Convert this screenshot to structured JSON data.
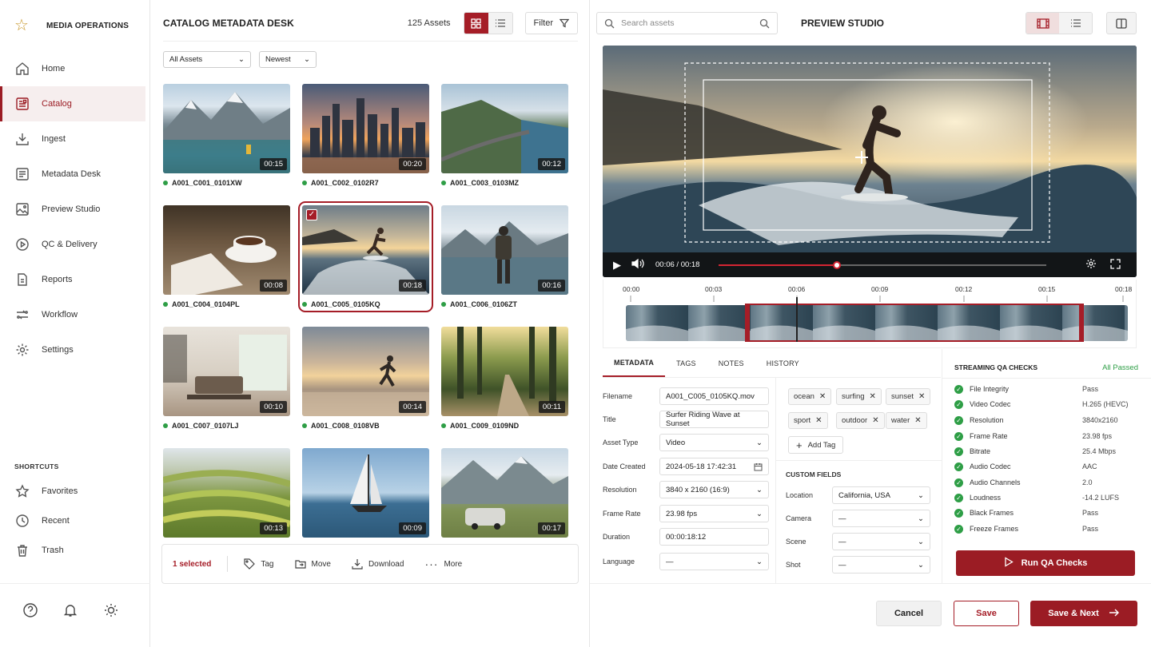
{
  "app": {
    "name": "MEDIA OPERATIONS"
  },
  "sidebar": {
    "items": [
      {
        "label": "Home"
      },
      {
        "label": "Catalog"
      },
      {
        "label": "Ingest"
      },
      {
        "label": "Metadata Desk"
      },
      {
        "label": "Preview Studio"
      },
      {
        "label": "QC & Delivery"
      },
      {
        "label": "Reports"
      },
      {
        "label": "Workflow"
      },
      {
        "label": "Settings"
      }
    ],
    "shortcuts_label": "SHORTCUTS",
    "shortcuts": [
      {
        "label": "Favorites"
      },
      {
        "label": "Recent"
      },
      {
        "label": "Trash"
      }
    ]
  },
  "catalog": {
    "title": "CATALOG METADATA DESK",
    "count": "125 Assets",
    "filter_label": "Filter",
    "filter1": "All Assets",
    "filter2": "Newest",
    "assets": [
      {
        "name": "A001_C001_0101XW",
        "duration": "00:15"
      },
      {
        "name": "A001_C002_0102R7",
        "duration": "00:20"
      },
      {
        "name": "A001_C003_0103MZ",
        "duration": "00:12"
      },
      {
        "name": "A001_C004_0104PL",
        "duration": "00:08"
      },
      {
        "name": "A001_C005_0105KQ",
        "duration": "00:18"
      },
      {
        "name": "A001_C006_0106ZT",
        "duration": "00:16"
      },
      {
        "name": "A001_C007_0107LJ",
        "duration": "00:10"
      },
      {
        "name": "A001_C008_0108VB",
        "duration": "00:14"
      },
      {
        "name": "A001_C009_0109ND",
        "duration": "00:11"
      },
      {
        "name": "",
        "duration": "00:13"
      },
      {
        "name": "",
        "duration": "00:09"
      },
      {
        "name": "",
        "duration": "00:17"
      }
    ],
    "selection": {
      "count": "1 selected",
      "tag": "Tag",
      "move": "Move",
      "download": "Download",
      "more": "More"
    }
  },
  "search": {
    "placeholder": "Search assets"
  },
  "preview": {
    "title": "PREVIEW STUDIO",
    "time": "00:06 / 00:18",
    "progress": 0.36,
    "ticks": [
      "00:00",
      "00:03",
      "00:06",
      "00:09",
      "00:12",
      "00:15",
      "00:18"
    ]
  },
  "tabs": [
    "METADATA",
    "TAGS",
    "NOTES",
    "HISTORY"
  ],
  "metadata": [
    {
      "label": "Filename",
      "value": "A001_C005_0105KQ.mov"
    },
    {
      "label": "Title",
      "value": "Surfer Riding Wave at Sunset"
    },
    {
      "label": "Asset Type",
      "value": "Video"
    },
    {
      "label": "Date Created",
      "value": "2024-05-18 17:42:31"
    },
    {
      "label": "Resolution",
      "value": "3840 x 2160 (16:9)"
    },
    {
      "label": "Frame Rate",
      "value": "23.98 fps"
    },
    {
      "label": "Duration",
      "value": "00:00:18:12"
    },
    {
      "label": "Language",
      "value": "—"
    }
  ],
  "tags": [
    "ocean",
    "surfing",
    "sunset",
    "sport",
    "outdoor",
    "water"
  ],
  "add_tag": "Add Tag",
  "custom_fields": {
    "label": "CUSTOM FIELDS",
    "fields": [
      {
        "label": "Location",
        "value": "California, USA"
      },
      {
        "label": "Camera",
        "value": "—"
      },
      {
        "label": "Scene",
        "value": "—"
      },
      {
        "label": "Shot",
        "value": "—"
      }
    ]
  },
  "qa": {
    "title": "STREAMING QA CHECKS",
    "status": "All Passed",
    "checks": [
      {
        "name": "File Integrity",
        "result": "Pass"
      },
      {
        "name": "Video Codec",
        "result": "H.265 (HEVC)"
      },
      {
        "name": "Resolution",
        "result": "3840x2160"
      },
      {
        "name": "Frame Rate",
        "result": "23.98 fps"
      },
      {
        "name": "Bitrate",
        "result": "25.4 Mbps"
      },
      {
        "name": "Audio Codec",
        "result": "AAC"
      },
      {
        "name": "Audio Channels",
        "result": "2.0"
      },
      {
        "name": "Loudness",
        "result": "-14.2 LUFS"
      },
      {
        "name": "Black Frames",
        "result": "Pass"
      },
      {
        "name": "Freeze Frames",
        "result": "Pass"
      }
    ],
    "run_label": "Run QA Checks"
  },
  "footer": {
    "cancel": "Cancel",
    "save": "Save",
    "save_next": "Save & Next"
  },
  "colors": {
    "accent": "#9b1c24",
    "success": "#2e9e46"
  }
}
